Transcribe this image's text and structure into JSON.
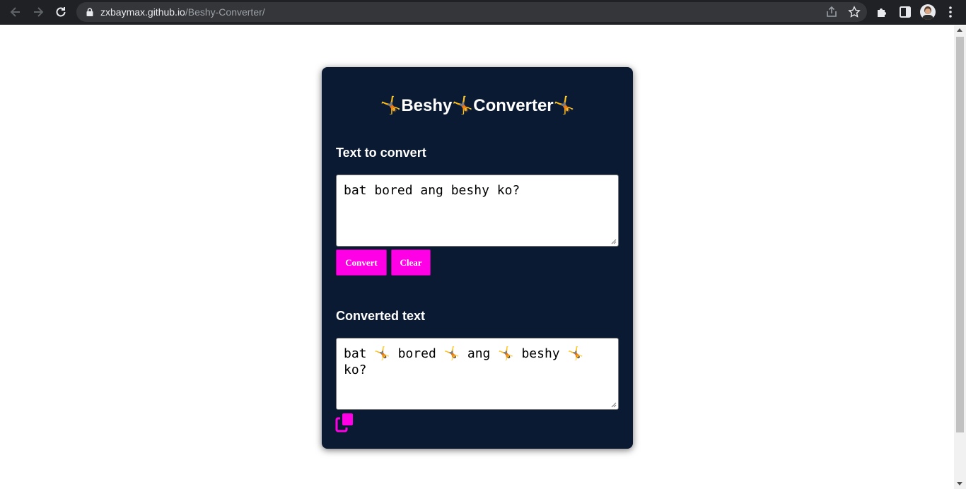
{
  "browser": {
    "url_host": "zxbaymax.github.io",
    "url_path": "/Beshy-Converter/"
  },
  "app": {
    "title_parts": [
      "🤸",
      "Beshy",
      "🤸",
      "Converter",
      "🤸"
    ],
    "input_label": "Text to convert",
    "input_value": "bat bored ang beshy ko?",
    "convert_label": "Convert",
    "clear_label": "Clear",
    "output_label": "Converted text",
    "output_value": "bat 🤸 bored 🤸 ang 🤸 beshy 🤸 ko?",
    "accent_color": "#ff00e6",
    "card_color": "#0b1a33"
  },
  "icons": {
    "back": "arrow-left-icon",
    "forward": "arrow-right-icon",
    "reload": "reload-icon",
    "lock": "lock-icon",
    "share": "share-icon",
    "bookmark": "star-icon",
    "extensions": "puzzle-icon",
    "side_panel": "side-panel-icon",
    "menu": "kebab-menu-icon",
    "copy": "copy-icon"
  }
}
